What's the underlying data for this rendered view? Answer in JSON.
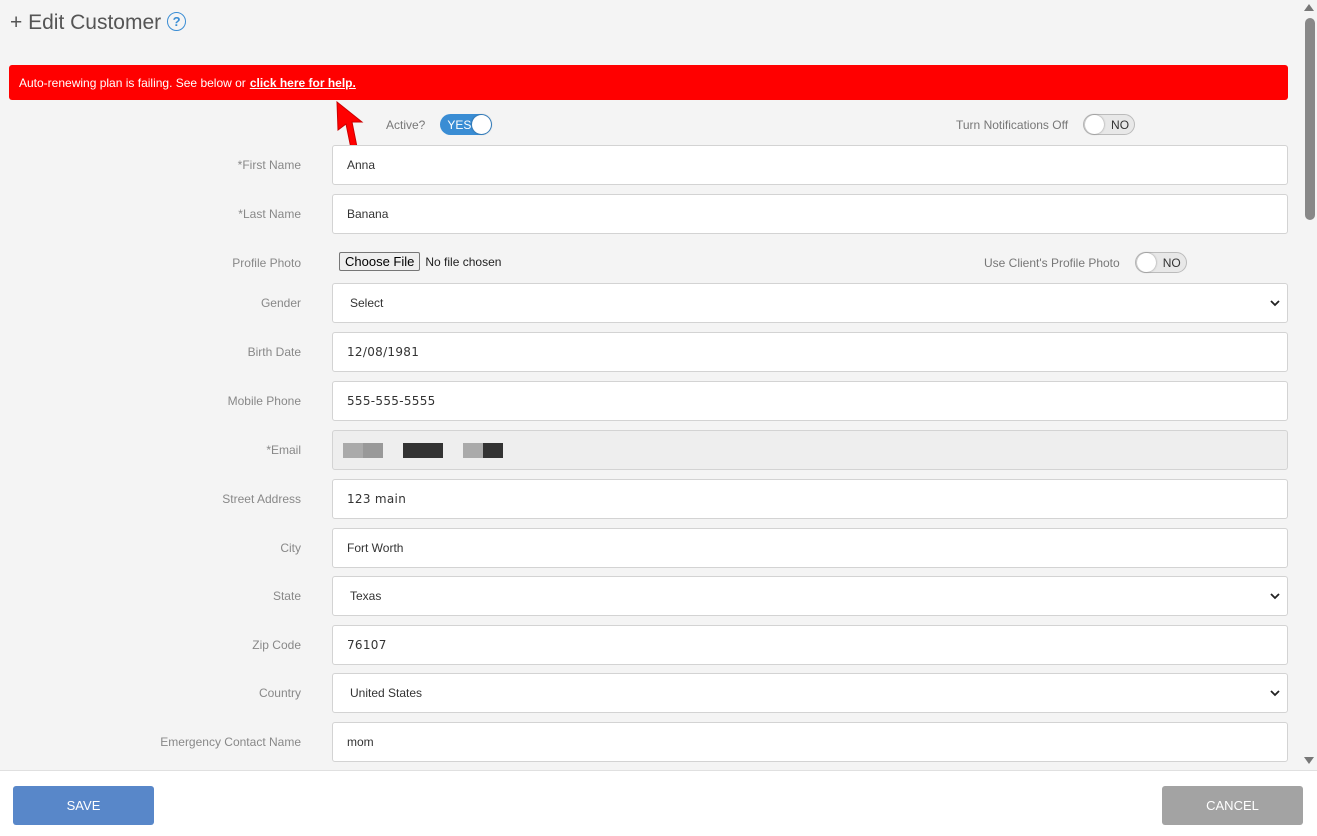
{
  "header": {
    "title": "+ Edit Customer",
    "help_icon": "question-circle-icon"
  },
  "alert": {
    "message": "Auto-renewing plan is failing. See below or",
    "link": "click here for help.",
    "color": "#ff0000"
  },
  "toggles": {
    "active": {
      "label": "Active?",
      "state": "YES"
    },
    "notifications": {
      "label": "Turn Notifications Off",
      "state": "NO"
    },
    "client_photo": {
      "label": "Use Client's Profile Photo",
      "state": "NO"
    }
  },
  "form": {
    "first_name": {
      "label": "*First Name",
      "value": "Anna"
    },
    "last_name": {
      "label": "*Last Name",
      "value": "Banana"
    },
    "profile_photo": {
      "label": "Profile Photo",
      "button": "Choose File",
      "status": "No file chosen"
    },
    "gender": {
      "label": "Gender",
      "value": "Select"
    },
    "birth_date": {
      "label": "Birth Date",
      "value": "12/08/1981"
    },
    "mobile_phone": {
      "label": "Mobile Phone",
      "value": "555-555-5555"
    },
    "email": {
      "label": "*Email"
    },
    "street": {
      "label": "Street Address",
      "value": "123 main"
    },
    "city": {
      "label": "City",
      "value": "Fort Worth"
    },
    "state": {
      "label": "State",
      "value": "Texas"
    },
    "zip": {
      "label": "Zip Code",
      "value": "76107"
    },
    "country": {
      "label": "Country",
      "value": "United States"
    },
    "emergency_name": {
      "label": "Emergency Contact Name",
      "value": "mom"
    }
  },
  "footer": {
    "save": "SAVE",
    "cancel": "CANCEL"
  },
  "colors": {
    "primary": "#5887c9",
    "toggle_on": "#3a8dd4",
    "cancel": "#a3a3a3"
  }
}
